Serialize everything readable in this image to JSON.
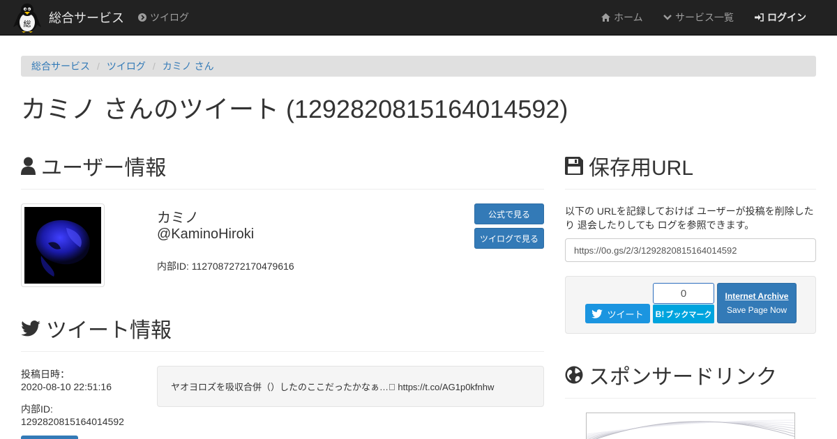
{
  "nav": {
    "brand": "総合サービス",
    "service_link": "ツイログ",
    "home": "ホーム",
    "services": "サービス一覧",
    "login": "ログイン"
  },
  "breadcrumb": [
    "総合サービス",
    "ツイログ",
    "カミノ さん"
  ],
  "page_title": "カミノ さんのツイート (1292820815164014592)",
  "user_section": {
    "title": "ユーザー情報",
    "name": "カミノ",
    "handle": "@KaminoHiroki",
    "internal_id": "内部ID: 1127087272170479616",
    "btn_official": "公式で見る",
    "btn_twilog": "ツイログで見る"
  },
  "tweet_section": {
    "title": "ツイート情報",
    "posted_label": "投稿日時：",
    "posted_value": "2020-08-10 22:51:16",
    "id_label": "内部ID:",
    "id_value": "1292820815164014592",
    "text": "ヤオヨロズを吸収合併（）したのここだったかなぁ…􏿾 https://t.co/AG1p0kfnhw"
  },
  "archive_section": {
    "title": "保存用URL",
    "description": "以下の URLを記録しておけば ユーザーが投稿を削除したり 退会したりしても ログを参照できます。",
    "url": "https://0o.gs/2/3/1292820815164014592",
    "tweet_btn": "ツイート",
    "hatena_count": "0",
    "hatena_label": "ブックマーク",
    "hatena_b": "B!",
    "ia_title": "Internet Archive",
    "ia_sub": "Save Page Now"
  },
  "sponsor_section": {
    "title": "スポンサードリンク"
  },
  "colors": {
    "navbar": "#222222",
    "primary": "#337ab7",
    "twitter": "#1b95e0",
    "hatena": "#00a4de"
  }
}
